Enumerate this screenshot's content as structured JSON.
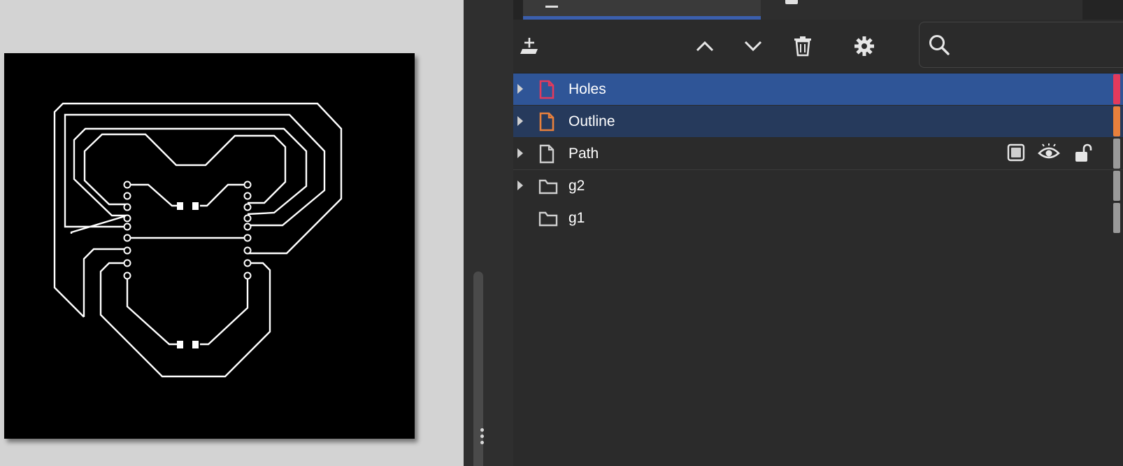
{
  "tabs": [
    {
      "name": "layers-tab",
      "label": ""
    },
    {
      "name": "objects-tab",
      "label": ""
    }
  ],
  "toolbar": {
    "buttons": [
      {
        "name": "add-layer-button",
        "icon": "add-layer-icon"
      },
      {
        "name": "move-up-button",
        "icon": "chevron-up-icon"
      },
      {
        "name": "move-down-button",
        "icon": "chevron-down-icon"
      },
      {
        "name": "delete-button",
        "icon": "trash-icon"
      },
      {
        "name": "settings-button",
        "icon": "gear-icon"
      }
    ],
    "search": {
      "placeholder": "",
      "value": ""
    }
  },
  "layers": [
    {
      "label": "Holes",
      "kind": "layer",
      "expandable": true,
      "selected": true,
      "icon_color": "#e33a5c",
      "tag_color": "#e33a5c",
      "row_bg": "#2f5597"
    },
    {
      "label": "Outline",
      "kind": "layer",
      "expandable": true,
      "selected": true,
      "icon_color": "#e8803c",
      "tag_color": "#e8803c",
      "row_bg": "#263a5c"
    },
    {
      "label": "Path",
      "kind": "layer",
      "expandable": true,
      "selected": false,
      "icon_color": "#cfcfcf",
      "tag_color": "#9a9a9a",
      "row_bg": "#2b2b2b",
      "hover_tools": [
        "checkbox-icon",
        "eye-icon",
        "unlock-icon"
      ]
    },
    {
      "label": "g2",
      "kind": "group",
      "expandable": true,
      "selected": false,
      "icon_color": "#cfcfcf",
      "tag_color": "#9a9a9a",
      "row_bg": "#2b2b2b"
    },
    {
      "label": "g1",
      "kind": "group",
      "expandable": false,
      "selected": false,
      "icon_color": "#cfcfcf",
      "tag_color": "#9a9a9a",
      "row_bg": "#2b2b2b"
    }
  ],
  "colors": {
    "canvas_bg": "#d3d3d3",
    "artboard_bg": "#000000",
    "trace": "#ffffff",
    "panel_bg": "#2b2b2b",
    "accent": "#3b5fad"
  }
}
